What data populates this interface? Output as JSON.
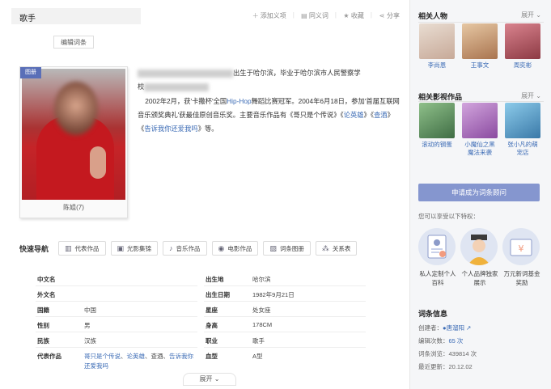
{
  "header": {
    "title": "歌手",
    "actions": [
      {
        "icon": "plus-icon",
        "label": "添加义项"
      },
      {
        "icon": "document-icon",
        "label": "同义词"
      },
      {
        "icon": "star-icon",
        "label": "收藏"
      },
      {
        "icon": "share-icon",
        "label": "分享"
      }
    ],
    "edit_label": "编辑词条"
  },
  "album": {
    "tag": "图册",
    "caption": "陈姐(7)"
  },
  "summary": {
    "p1_part1": "出生于哈尔滨，毕业于哈尔滨市人民警察学",
    "p1_part2": "校",
    "p2_part1": "2002年2月，获'卡撒杯'全国",
    "p2_link1": "Hip-Hop",
    "p2_part2": "舞蹈比赛冠军。2004年6月18日，参加'首届互联网音乐颁奖典礼'获最佳原创音乐奖。主要音乐作品有《哥只是个传说》《",
    "p2_link2": "论英雄",
    "p2_part3": "》《",
    "p2_link3": "查酒",
    "p2_part4": "》《",
    "p2_link4": "告诉我你还爱我吗",
    "p2_part5": "》等。"
  },
  "quicknav": {
    "label": "快速导航",
    "items": [
      {
        "icon": "book-icon",
        "label": "代表作品"
      },
      {
        "icon": "film-frame-icon",
        "label": "光影集锦"
      },
      {
        "icon": "music-icon",
        "label": "音乐作品"
      },
      {
        "icon": "film-reel-icon",
        "label": "电影作品"
      },
      {
        "icon": "image-icon",
        "label": "词条图册"
      },
      {
        "icon": "network-icon",
        "label": "关系表"
      }
    ]
  },
  "info": {
    "rows": [
      {
        "k": "中文名",
        "v": "",
        "k2": "出生地",
        "v2": "哈尔滨"
      },
      {
        "k": "外文名",
        "v": "",
        "k2": "出生日期",
        "v2": "1982年9月21日"
      },
      {
        "k": "国籍",
        "v": "中国",
        "k2": "星座",
        "v2": "处女座"
      },
      {
        "k": "性别",
        "v": "男",
        "k2": "身高",
        "v2": "178CM"
      },
      {
        "k": "民族",
        "v": "汉族",
        "k2": "职业",
        "v2": "歌手"
      },
      {
        "k": "代表作品",
        "v": "",
        "k2": "血型",
        "v2": "A型"
      }
    ],
    "works": {
      "w1": "哥只是个传说",
      "sep1": "、",
      "w2": "论英雄",
      "sep2": "、查酒、",
      "w3": "告诉我你还爱我吗"
    },
    "expand_label": "展开"
  },
  "sidebar": {
    "related_people_title": "相关人物",
    "related_people_more": "展开",
    "people": [
      {
        "name": "李尚恩",
        "color": "#d8c9bd"
      },
      {
        "name": "王事文",
        "color": "#d9b48f"
      },
      {
        "name": "周奕彬",
        "color": "#b45b66"
      }
    ],
    "related_media_title": "相关影视作品",
    "related_media_more": "展开",
    "media": [
      {
        "name": "滚动的钢蛋",
        "color": "#6b9b6a"
      },
      {
        "name": "小魔仙之黑魔法来袭",
        "color": "#b97cc6"
      },
      {
        "name": "张小凡的萌宠店",
        "color": "#5aaad6"
      }
    ],
    "apply_label": "申请成为词条顾问",
    "perks_question": "您可以享受以下特权：",
    "perks": [
      {
        "icon": "id-card-icon",
        "label": "私人定制个人百科"
      },
      {
        "icon": "emperor-icon",
        "label": "个人品牌独家展示"
      },
      {
        "icon": "money-icon",
        "label": "万元新词基金奖励"
      }
    ],
    "entry_info_title": "词条信息",
    "creator_label": "创建者：",
    "creator_value": "●唐溜阳",
    "edits_label": "编辑次数：",
    "edits_value": "65 次",
    "views_label": "词条浏览：",
    "views_value": "439814 次",
    "updated_label": "最近更新：",
    "updated_value": "20.12.02"
  }
}
